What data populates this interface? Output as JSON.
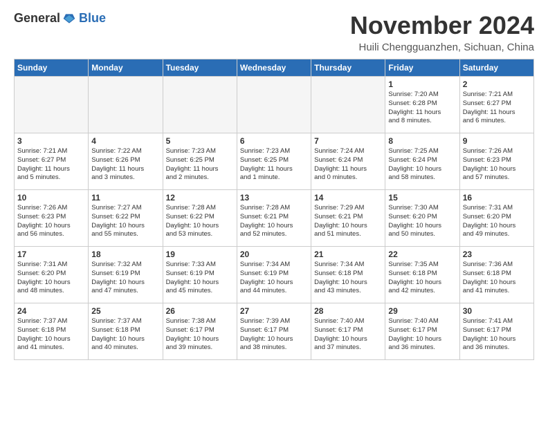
{
  "header": {
    "logo_general": "General",
    "logo_blue": "Blue",
    "month": "November 2024",
    "location": "Huili Chengguanzhen, Sichuan, China"
  },
  "weekdays": [
    "Sunday",
    "Monday",
    "Tuesday",
    "Wednesday",
    "Thursday",
    "Friday",
    "Saturday"
  ],
  "weeks": [
    [
      {
        "day": "",
        "info": ""
      },
      {
        "day": "",
        "info": ""
      },
      {
        "day": "",
        "info": ""
      },
      {
        "day": "",
        "info": ""
      },
      {
        "day": "",
        "info": ""
      },
      {
        "day": "1",
        "info": "Sunrise: 7:20 AM\nSunset: 6:28 PM\nDaylight: 11 hours\nand 8 minutes."
      },
      {
        "day": "2",
        "info": "Sunrise: 7:21 AM\nSunset: 6:27 PM\nDaylight: 11 hours\nand 6 minutes."
      }
    ],
    [
      {
        "day": "3",
        "info": "Sunrise: 7:21 AM\nSunset: 6:27 PM\nDaylight: 11 hours\nand 5 minutes."
      },
      {
        "day": "4",
        "info": "Sunrise: 7:22 AM\nSunset: 6:26 PM\nDaylight: 11 hours\nand 3 minutes."
      },
      {
        "day": "5",
        "info": "Sunrise: 7:23 AM\nSunset: 6:25 PM\nDaylight: 11 hours\nand 2 minutes."
      },
      {
        "day": "6",
        "info": "Sunrise: 7:23 AM\nSunset: 6:25 PM\nDaylight: 11 hours\nand 1 minute."
      },
      {
        "day": "7",
        "info": "Sunrise: 7:24 AM\nSunset: 6:24 PM\nDaylight: 11 hours\nand 0 minutes."
      },
      {
        "day": "8",
        "info": "Sunrise: 7:25 AM\nSunset: 6:24 PM\nDaylight: 10 hours\nand 58 minutes."
      },
      {
        "day": "9",
        "info": "Sunrise: 7:26 AM\nSunset: 6:23 PM\nDaylight: 10 hours\nand 57 minutes."
      }
    ],
    [
      {
        "day": "10",
        "info": "Sunrise: 7:26 AM\nSunset: 6:23 PM\nDaylight: 10 hours\nand 56 minutes."
      },
      {
        "day": "11",
        "info": "Sunrise: 7:27 AM\nSunset: 6:22 PM\nDaylight: 10 hours\nand 55 minutes."
      },
      {
        "day": "12",
        "info": "Sunrise: 7:28 AM\nSunset: 6:22 PM\nDaylight: 10 hours\nand 53 minutes."
      },
      {
        "day": "13",
        "info": "Sunrise: 7:28 AM\nSunset: 6:21 PM\nDaylight: 10 hours\nand 52 minutes."
      },
      {
        "day": "14",
        "info": "Sunrise: 7:29 AM\nSunset: 6:21 PM\nDaylight: 10 hours\nand 51 minutes."
      },
      {
        "day": "15",
        "info": "Sunrise: 7:30 AM\nSunset: 6:20 PM\nDaylight: 10 hours\nand 50 minutes."
      },
      {
        "day": "16",
        "info": "Sunrise: 7:31 AM\nSunset: 6:20 PM\nDaylight: 10 hours\nand 49 minutes."
      }
    ],
    [
      {
        "day": "17",
        "info": "Sunrise: 7:31 AM\nSunset: 6:20 PM\nDaylight: 10 hours\nand 48 minutes."
      },
      {
        "day": "18",
        "info": "Sunrise: 7:32 AM\nSunset: 6:19 PM\nDaylight: 10 hours\nand 47 minutes."
      },
      {
        "day": "19",
        "info": "Sunrise: 7:33 AM\nSunset: 6:19 PM\nDaylight: 10 hours\nand 45 minutes."
      },
      {
        "day": "20",
        "info": "Sunrise: 7:34 AM\nSunset: 6:19 PM\nDaylight: 10 hours\nand 44 minutes."
      },
      {
        "day": "21",
        "info": "Sunrise: 7:34 AM\nSunset: 6:18 PM\nDaylight: 10 hours\nand 43 minutes."
      },
      {
        "day": "22",
        "info": "Sunrise: 7:35 AM\nSunset: 6:18 PM\nDaylight: 10 hours\nand 42 minutes."
      },
      {
        "day": "23",
        "info": "Sunrise: 7:36 AM\nSunset: 6:18 PM\nDaylight: 10 hours\nand 41 minutes."
      }
    ],
    [
      {
        "day": "24",
        "info": "Sunrise: 7:37 AM\nSunset: 6:18 PM\nDaylight: 10 hours\nand 41 minutes."
      },
      {
        "day": "25",
        "info": "Sunrise: 7:37 AM\nSunset: 6:18 PM\nDaylight: 10 hours\nand 40 minutes."
      },
      {
        "day": "26",
        "info": "Sunrise: 7:38 AM\nSunset: 6:17 PM\nDaylight: 10 hours\nand 39 minutes."
      },
      {
        "day": "27",
        "info": "Sunrise: 7:39 AM\nSunset: 6:17 PM\nDaylight: 10 hours\nand 38 minutes."
      },
      {
        "day": "28",
        "info": "Sunrise: 7:40 AM\nSunset: 6:17 PM\nDaylight: 10 hours\nand 37 minutes."
      },
      {
        "day": "29",
        "info": "Sunrise: 7:40 AM\nSunset: 6:17 PM\nDaylight: 10 hours\nand 36 minutes."
      },
      {
        "day": "30",
        "info": "Sunrise: 7:41 AM\nSunset: 6:17 PM\nDaylight: 10 hours\nand 36 minutes."
      }
    ]
  ]
}
